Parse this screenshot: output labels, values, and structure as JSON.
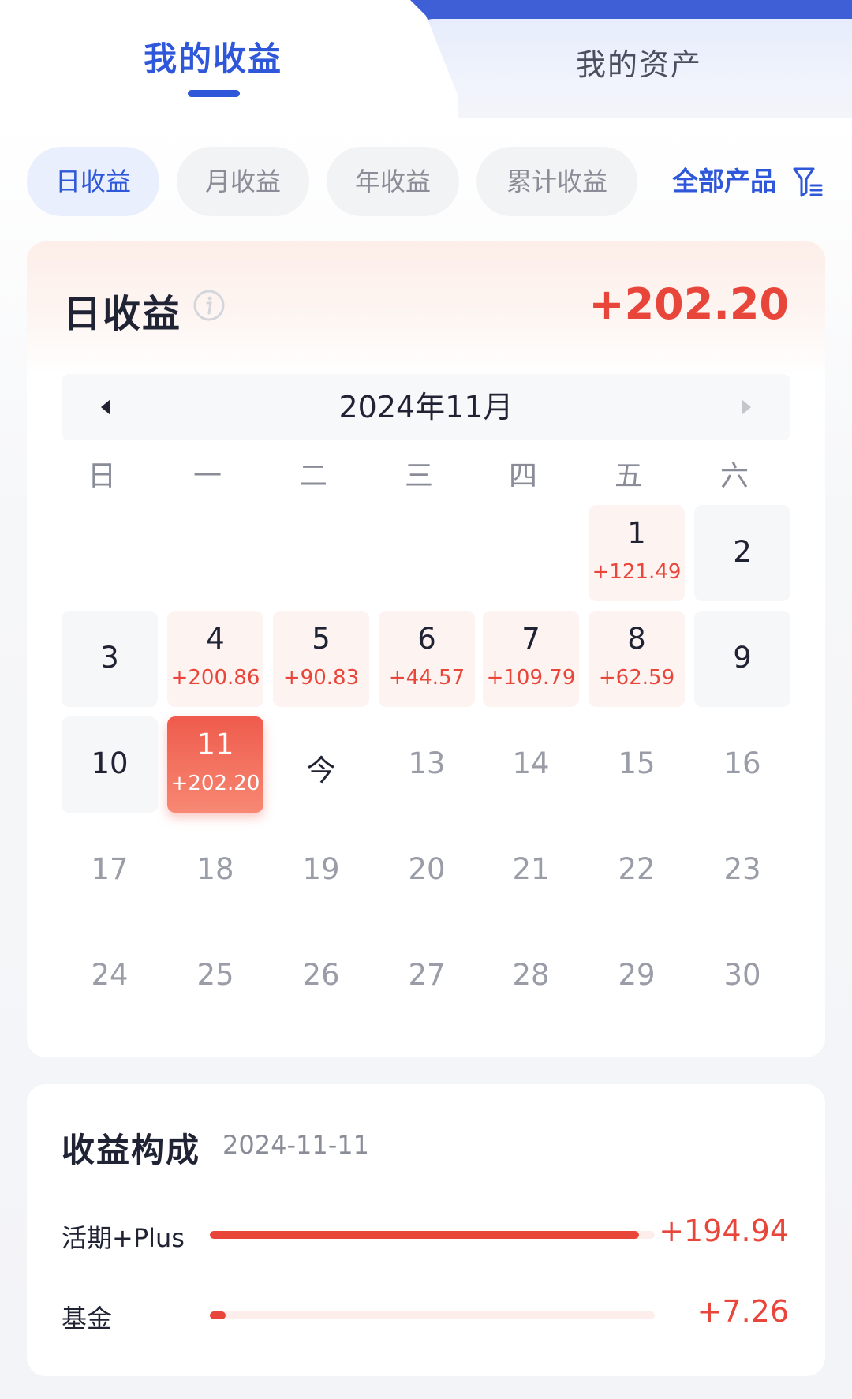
{
  "header": {
    "tabs": [
      {
        "label": "我的收益",
        "active": true
      },
      {
        "label": "我的资产",
        "active": false
      }
    ]
  },
  "filters": {
    "items": [
      {
        "label": "日收益",
        "active": true
      },
      {
        "label": "月收益",
        "active": false
      },
      {
        "label": "年收益",
        "active": false
      },
      {
        "label": "累计收益",
        "active": false
      }
    ],
    "all_products": "全部产品",
    "filter_icon": "filter-funnel-icon"
  },
  "daily": {
    "title": "日收益",
    "info_icon": "info-icon",
    "total": "+202.20"
  },
  "calendar": {
    "month": "2024年11月",
    "weekdays": [
      "日",
      "一",
      "二",
      "三",
      "四",
      "五",
      "六"
    ],
    "days": {
      "1": {
        "num": "1",
        "amt": "+121.49"
      },
      "2": {
        "num": "2"
      },
      "3": {
        "num": "3"
      },
      "4": {
        "num": "4",
        "amt": "+200.86"
      },
      "5": {
        "num": "5",
        "amt": "+90.83"
      },
      "6": {
        "num": "6",
        "amt": "+44.57"
      },
      "7": {
        "num": "7",
        "amt": "+109.79"
      },
      "8": {
        "num": "8",
        "amt": "+62.59"
      },
      "9": {
        "num": "9"
      },
      "10": {
        "num": "10"
      },
      "11": {
        "num": "11",
        "amt": "+202.20",
        "selected": true
      },
      "12": {
        "num": "今"
      },
      "13": {
        "num": "13"
      },
      "14": {
        "num": "14"
      },
      "15": {
        "num": "15"
      },
      "16": {
        "num": "16"
      },
      "17": {
        "num": "17"
      },
      "18": {
        "num": "18"
      },
      "19": {
        "num": "19"
      },
      "20": {
        "num": "20"
      },
      "21": {
        "num": "21"
      },
      "22": {
        "num": "22"
      },
      "23": {
        "num": "23"
      },
      "24": {
        "num": "24"
      },
      "25": {
        "num": "25"
      },
      "26": {
        "num": "26"
      },
      "27": {
        "num": "27"
      },
      "28": {
        "num": "28"
      },
      "29": {
        "num": "29"
      },
      "30": {
        "num": "30"
      }
    }
  },
  "composition": {
    "title": "收益构成",
    "date": "2024-11-11",
    "items": [
      {
        "label": "活期+Plus",
        "value": "+194.94",
        "share": 0.964
      },
      {
        "label": "基金",
        "value": "+7.26",
        "share": 0.036
      }
    ]
  },
  "colors": {
    "brand_blue": "#2f57d9",
    "gain_red": "#e8463a",
    "gain_bg": "#fdf3f1"
  }
}
